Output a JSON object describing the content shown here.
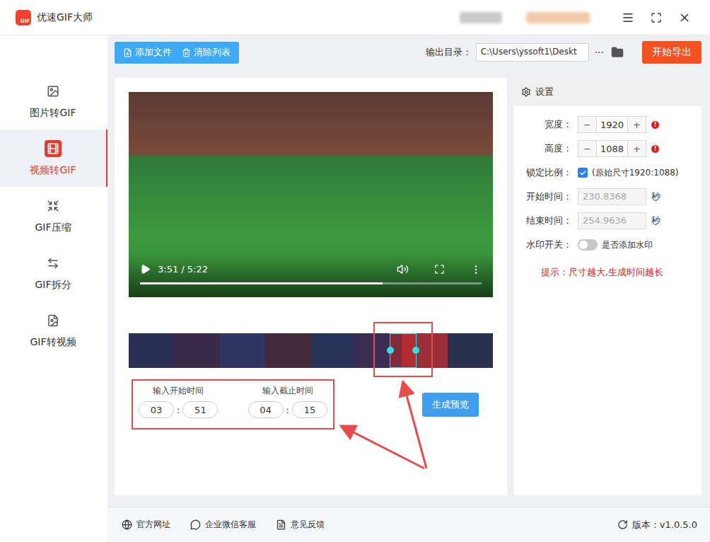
{
  "window": {
    "title": "优速GIF大师",
    "logo_text": "GIF"
  },
  "sidebar": {
    "items": [
      {
        "label": "图片转GIF",
        "selected": false
      },
      {
        "label": "视频转GIF",
        "selected": true
      },
      {
        "label": "GIF压缩",
        "selected": false
      },
      {
        "label": "GIF拆分",
        "selected": false
      },
      {
        "label": "GIF转视频",
        "selected": false
      }
    ]
  },
  "toolbar": {
    "buttons": [
      {
        "label": "添加文件"
      },
      {
        "label": "清除列表"
      }
    ],
    "output_label": "输出目录：",
    "output_path": "C:\\Users\\yssoft1\\Deskt",
    "more": "···",
    "export_button": "开始导出"
  },
  "player": {
    "time": "3:51 / 5:22",
    "level": 0.71
  },
  "filmstrip": {
    "selection": {
      "start": 0.717,
      "end": 0.79
    }
  },
  "trim": {
    "start": {
      "label": "输入开始时间",
      "minutes": "03",
      "seconds": "51"
    },
    "end": {
      "label": "输入截止时间",
      "minutes": "04",
      "seconds": "15"
    },
    "separator": ":"
  },
  "preview_button": "生成预览",
  "settings": {
    "title": "设置",
    "rows": [
      {
        "kind": "stepper",
        "label": "宽度：",
        "value": "1920",
        "minus": "−",
        "plus": "+",
        "alert": "!"
      },
      {
        "kind": "stepper",
        "label": "高度：",
        "value": "1088",
        "minus": "−",
        "plus": "+",
        "alert": "!"
      },
      {
        "kind": "checkbox",
        "label": "锁定比例：",
        "checked": true,
        "note": "(原始尺寸1920:1088)"
      },
      {
        "kind": "time",
        "label": "开始时间：",
        "value": "230.8368",
        "unit": "秒",
        "disabled": true
      },
      {
        "kind": "time",
        "label": "结束时间：",
        "value": "254.9636",
        "unit": "秒",
        "disabled": true
      },
      {
        "kind": "toggle",
        "label": "水印开关：",
        "on": false,
        "note": "是否添加水印"
      }
    ],
    "tip": "提示：尺寸越大,生成时间越长"
  },
  "footer": {
    "links": [
      "官方网址",
      "企业微信客服",
      "意见反馈"
    ],
    "version": "版本：v1.0.5.0"
  }
}
